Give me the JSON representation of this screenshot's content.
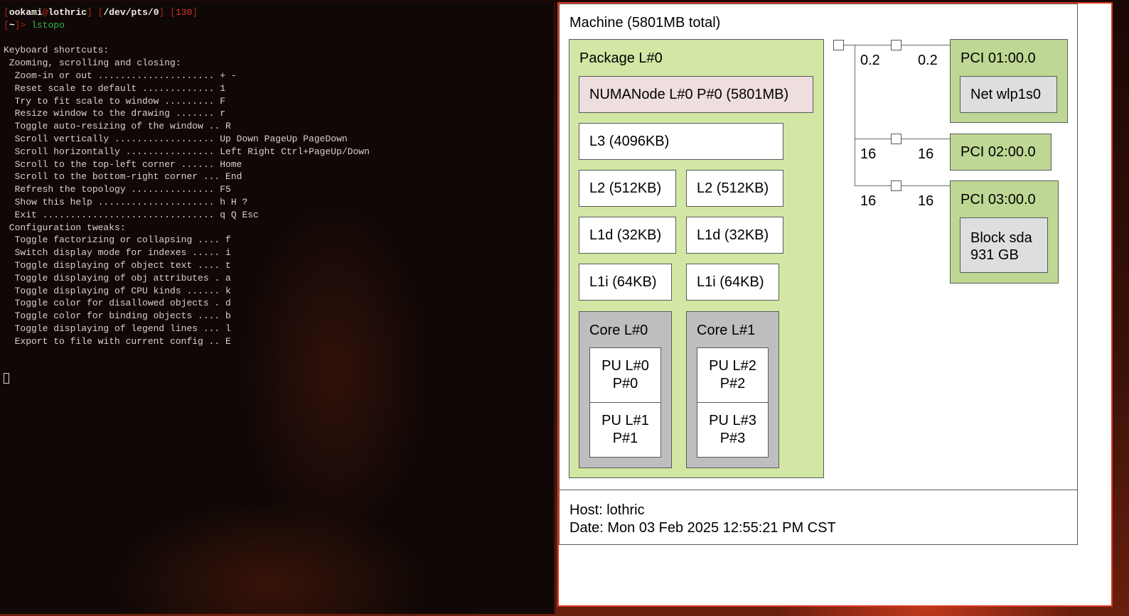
{
  "terminal": {
    "prompt": {
      "user": "ookami",
      "host": "lothric",
      "tty": "/dev/pts/0",
      "exit_code": "130",
      "cwd": "~",
      "arrow": ">",
      "command": "lstopo"
    },
    "help_lines": [
      "",
      "Keyboard shortcuts:",
      " Zooming, scrolling and closing:",
      "  Zoom-in or out ..................... + -",
      "  Reset scale to default ............. 1",
      "  Try to fit scale to window ......... F",
      "  Resize window to the drawing ....... r",
      "  Toggle auto-resizing of the window .. R",
      "  Scroll vertically .................. Up Down PageUp PageDown",
      "  Scroll horizontally ................ Left Right Ctrl+PageUp/Down",
      "  Scroll to the top-left corner ...... Home",
      "  Scroll to the bottom-right corner ... End",
      "  Refresh the topology ............... F5",
      "  Show this help ..................... h H ?",
      "  Exit ............................... q Q Esc",
      " Configuration tweaks:",
      "  Toggle factorizing or collapsing .... f",
      "  Switch display mode for indexes ..... i",
      "  Toggle displaying of object text .... t",
      "  Toggle displaying of obj attributes . a",
      "  Toggle displaying of CPU kinds ...... k",
      "  Toggle color for disallowed objects . d",
      "  Toggle color for binding objects .... b",
      "  Toggle displaying of legend lines ... l",
      "  Export to file with current config .. E"
    ]
  },
  "lstopo": {
    "machine": "Machine (5801MB total)",
    "package": "Package L#0",
    "numa": "NUMANode L#0 P#0 (5801MB)",
    "l3": "L3 (4096KB)",
    "l2": [
      "L2 (512KB)",
      "L2 (512KB)"
    ],
    "l1d": [
      "L1d (32KB)",
      "L1d (32KB)"
    ],
    "l1i": [
      "L1i (64KB)",
      "L1i (64KB)"
    ],
    "cores": [
      {
        "label": "Core L#0",
        "pus": [
          [
            "PU L#0",
            "P#0"
          ],
          [
            "PU L#1",
            "P#1"
          ]
        ]
      },
      {
        "label": "Core L#1",
        "pus": [
          [
            "PU L#2",
            "P#2"
          ],
          [
            "PU L#3",
            "P#3"
          ]
        ]
      }
    ],
    "links": [
      {
        "left": "0.2",
        "right": "0.2"
      },
      {
        "left": "16",
        "right": "16"
      },
      {
        "left": "16",
        "right": "16"
      }
    ],
    "pci": [
      {
        "label": "PCI 01:00.0",
        "device": "Net wlp1s0"
      },
      {
        "label": "PCI 02:00.0"
      },
      {
        "label": "PCI 03:00.0",
        "device_line1": "Block sda",
        "device_line2": "931 GB"
      }
    ],
    "legend": {
      "host": "Host: lothric",
      "date": "Date: Mon 03 Feb 2025 12:55:21 PM CST"
    },
    "colors": {
      "package": "#d2e7a4",
      "numa": "#efdede",
      "core": "#bebebe",
      "pci": "#bed794",
      "device": "#dedede",
      "window_border": "#d83a22"
    }
  }
}
